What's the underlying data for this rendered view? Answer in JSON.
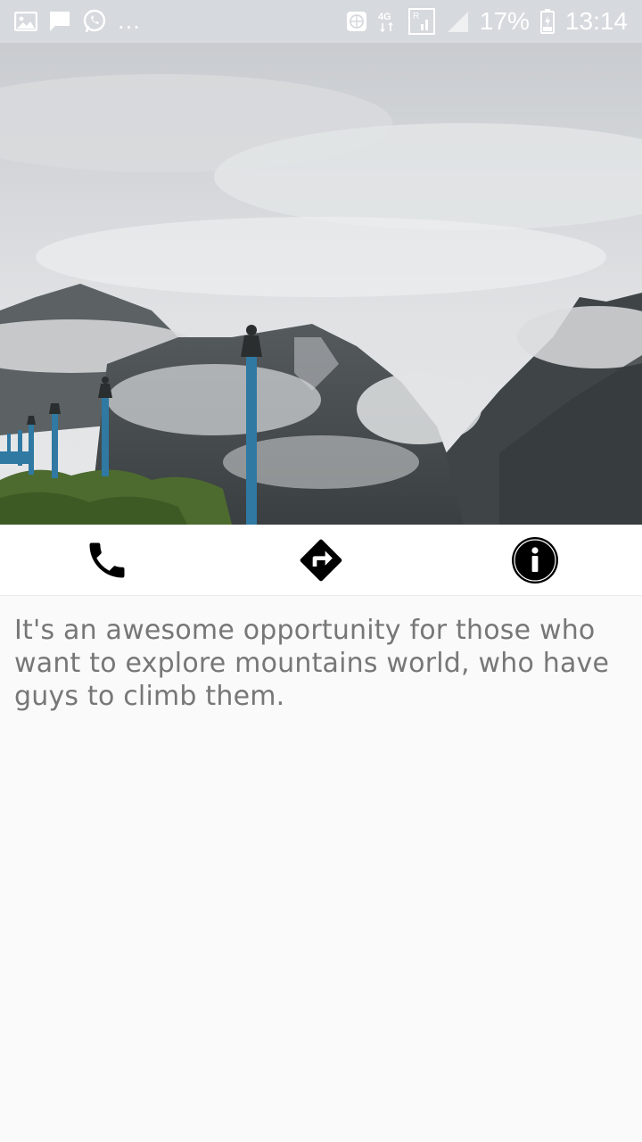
{
  "status_bar": {
    "left_icons": [
      "gallery-icon",
      "message-icon",
      "whatsapp-icon"
    ],
    "more_indicator": "...",
    "right_icons": [
      "vpn-globe-icon",
      "signal-4g-icon",
      "sim-signal-icon",
      "signal-strength-icon"
    ],
    "network_label": "4G",
    "battery": "17%",
    "time": "13:14"
  },
  "hero_image": {
    "subject": "clouded mountains with blue lamp posts",
    "colors": {
      "sky": "#d3d6d9",
      "cloud": "#e9ebec",
      "mountain_dark": "#3f4446",
      "mountain_mid": "#6a6f70",
      "lamp_post": "#2f79a3",
      "foliage": "#4d6b2f"
    }
  },
  "actions": [
    {
      "name": "call",
      "icon": "phone-icon"
    },
    {
      "name": "directions",
      "icon": "directions-icon"
    },
    {
      "name": "info",
      "icon": "info-icon"
    }
  ],
  "description": {
    "text": "It's an awesome opportunity for those who want to explore mountains world, who have guys to climb them.",
    "color": "#777777"
  }
}
